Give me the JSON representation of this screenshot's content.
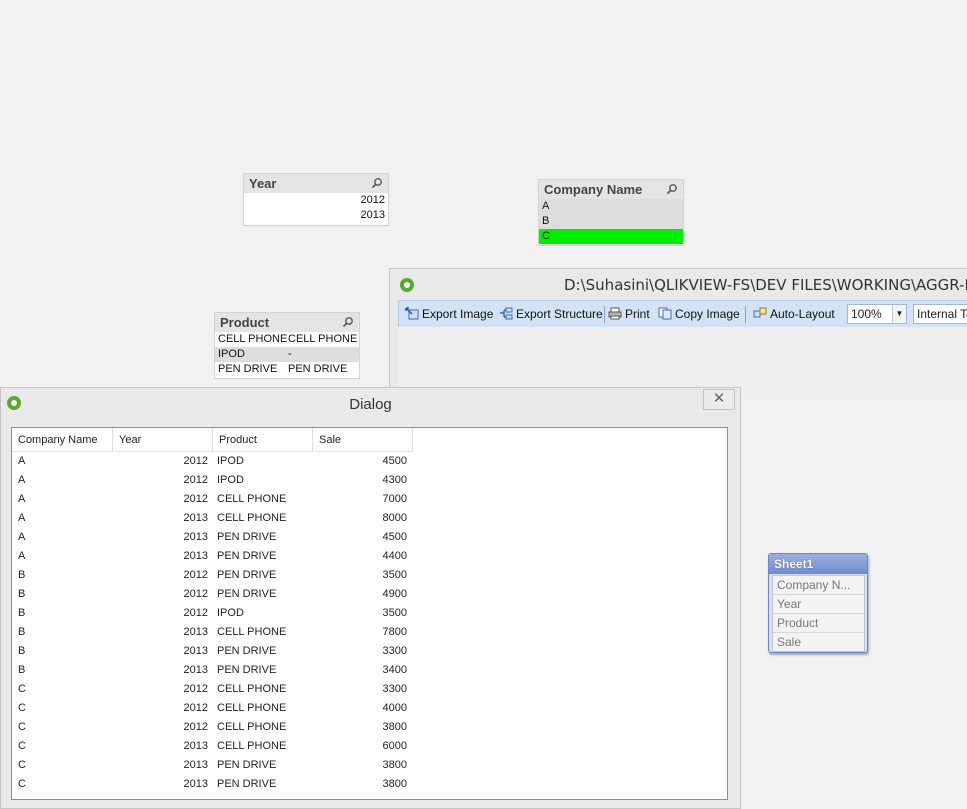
{
  "listboxes": {
    "year": {
      "title": "Year",
      "items": [
        "2012",
        "2013"
      ]
    },
    "company": {
      "title": "Company Name",
      "items": [
        "A",
        "B",
        "C"
      ],
      "selected": "C"
    },
    "product": {
      "title": "Product",
      "rows": [
        [
          "CELL PHONE",
          "CELL PHONE"
        ],
        [
          "IPOD",
          "-"
        ],
        [
          "PEN DRIVE",
          "PEN DRIVE"
        ]
      ]
    }
  },
  "table_viewer": {
    "title": "D:\\Suhasini\\QLIKVIEW-FS\\DEV FILES\\WORKING\\AGGR-FUNC-",
    "toolbar": {
      "export_image": "Export Image",
      "export_structure": "Export Structure",
      "print": "Print",
      "copy_image": "Copy Image",
      "auto_layout": "Auto-Layout",
      "zoom": "100%",
      "view": "Internal Table View"
    }
  },
  "sheet_table": {
    "title": "Sheet1",
    "fields": [
      "Company N...",
      "Year",
      "Product",
      "Sale"
    ]
  },
  "dialog": {
    "title": "Dialog",
    "close": "✕",
    "columns": [
      "Company Name",
      "Year",
      "Product",
      "Sale"
    ],
    "rows": [
      [
        "A",
        "2012",
        "IPOD",
        "4500"
      ],
      [
        "A",
        "2012",
        "IPOD",
        "4300"
      ],
      [
        "A",
        "2012",
        "CELL PHONE",
        "7000"
      ],
      [
        "A",
        "2013",
        "CELL PHONE",
        "8000"
      ],
      [
        "A",
        "2013",
        "PEN DRIVE",
        "4500"
      ],
      [
        "A",
        "2013",
        "PEN DRIVE",
        "4400"
      ],
      [
        "B",
        "2012",
        "PEN DRIVE",
        "3500"
      ],
      [
        "B",
        "2012",
        "PEN DRIVE",
        "4900"
      ],
      [
        "B",
        "2012",
        "IPOD",
        "3500"
      ],
      [
        "B",
        "2013",
        "CELL PHONE",
        "7800"
      ],
      [
        "B",
        "2013",
        "PEN DRIVE",
        "3300"
      ],
      [
        "B",
        "2013",
        "PEN DRIVE",
        "3400"
      ],
      [
        "C",
        "2012",
        "CELL PHONE",
        "3300"
      ],
      [
        "C",
        "2012",
        "CELL PHONE",
        "4000"
      ],
      [
        "C",
        "2012",
        "CELL PHONE",
        "3800"
      ],
      [
        "C",
        "2013",
        "CELL PHONE",
        "6000"
      ],
      [
        "C",
        "2013",
        "PEN DRIVE",
        "3800"
      ],
      [
        "C",
        "2013",
        "PEN DRIVE",
        "3800"
      ]
    ]
  },
  "colors": {
    "selected": "#00ee00",
    "alternative": "#dddddd",
    "qlik_green": "#5aa833",
    "toolbar": "#d3e2f5"
  },
  "icons": [
    "search-icon",
    "qlikview-logo-icon",
    "export-image-icon",
    "export-structure-icon",
    "print-icon",
    "copy-image-icon",
    "auto-layout-icon",
    "dropdown-arrow-icon",
    "close-icon"
  ]
}
